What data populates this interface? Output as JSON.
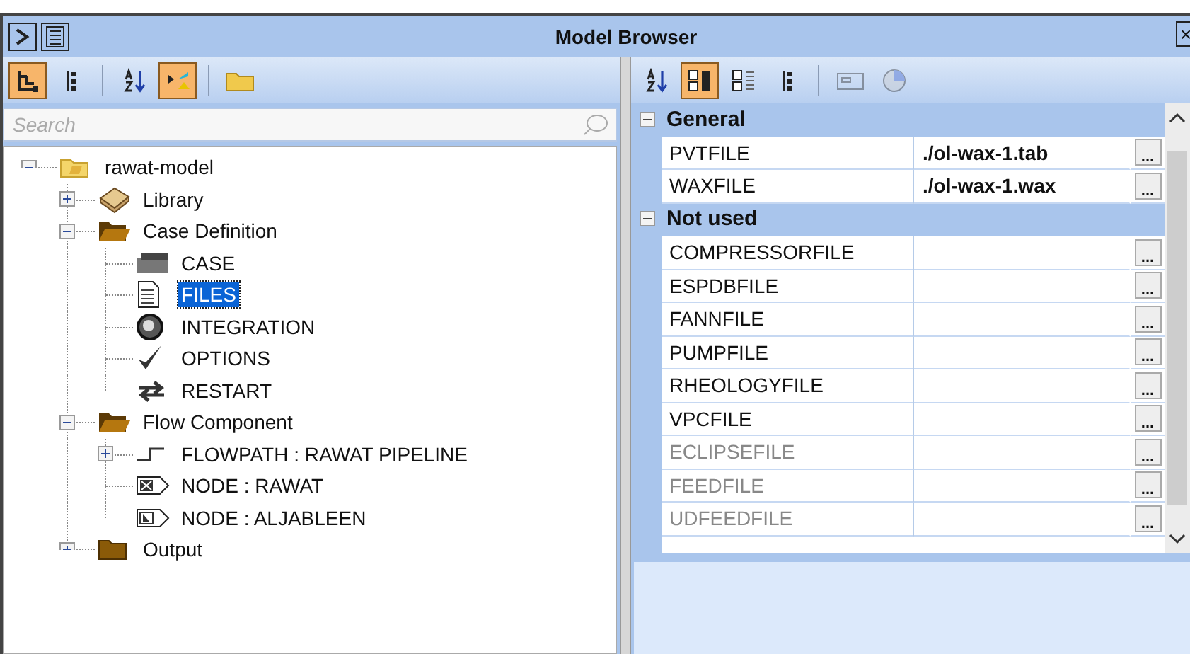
{
  "window": {
    "title": "Model Browser",
    "close": "×"
  },
  "left_toolbar": [
    {
      "kind": "tree",
      "selected": true
    },
    {
      "kind": "list",
      "selected": false
    },
    {
      "kind": "sort",
      "selected": false
    },
    {
      "kind": "filter",
      "selected": true
    },
    {
      "kind": "folder",
      "selected": false
    }
  ],
  "search": {
    "placeholder": "Search"
  },
  "tree": [
    {
      "label": "rawat-model",
      "kind": "project",
      "expanded": true,
      "selected": false,
      "children": [
        {
          "label": "Library",
          "kind": "book",
          "expanded": false,
          "selected": false
        },
        {
          "label": "Case Definition",
          "kind": "folder-open",
          "expanded": true,
          "selected": false,
          "children": [
            {
              "label": "CASE",
              "kind": "case",
              "selected": false
            },
            {
              "label": "FILES",
              "kind": "file",
              "selected": true
            },
            {
              "label": "INTEGRATION",
              "kind": "integration",
              "selected": false
            },
            {
              "label": "OPTIONS",
              "kind": "check",
              "selected": false
            },
            {
              "label": "RESTART",
              "kind": "restart",
              "selected": false
            }
          ]
        },
        {
          "label": "Flow Component",
          "kind": "folder-open",
          "expanded": true,
          "selected": false,
          "children": [
            {
              "label": "FLOWPATH : RAWAT PIPELINE",
              "kind": "flowpath",
              "expanded": false,
              "selected": false
            },
            {
              "label": "NODE : RAWAT",
              "kind": "node-x",
              "selected": false
            },
            {
              "label": "NODE : ALJABLEEN",
              "kind": "node-arrow",
              "selected": false
            }
          ]
        },
        {
          "label": "Output",
          "kind": "folder",
          "expanded": false,
          "selected": false
        }
      ]
    }
  ],
  "right_toolbar": [
    {
      "kind": "sort",
      "selected": false,
      "disabled": false
    },
    {
      "kind": "categorized",
      "selected": true,
      "disabled": false
    },
    {
      "kind": "alpha-list",
      "selected": false,
      "disabled": false
    },
    {
      "kind": "list",
      "selected": false,
      "disabled": false
    },
    {
      "kind": "grid",
      "selected": false,
      "disabled": true
    },
    {
      "kind": "pie",
      "selected": false,
      "disabled": true
    }
  ],
  "properties": [
    {
      "category": "General",
      "expanded": true,
      "rows": [
        {
          "name": "PVTFILE",
          "value": "./ol-wax-1.tab",
          "disabled": false,
          "button": "..."
        },
        {
          "name": "WAXFILE",
          "value": "./ol-wax-1.wax",
          "disabled": false,
          "button": "..."
        }
      ]
    },
    {
      "category": "Not used",
      "expanded": true,
      "rows": [
        {
          "name": "COMPRESSORFILE",
          "disabled": false,
          "button": "..."
        },
        {
          "name": "ESPDBFILE",
          "disabled": false,
          "button": "..."
        },
        {
          "name": "FANNFILE",
          "disabled": false,
          "button": "..."
        },
        {
          "name": "PUMPFILE",
          "disabled": false,
          "button": "..."
        },
        {
          "name": "RHEOLOGYFILE",
          "disabled": false,
          "button": "..."
        },
        {
          "name": "VPCFILE",
          "disabled": false,
          "button": "..."
        },
        {
          "name": "ECLIPSEFILE",
          "disabled": true,
          "button": "..."
        },
        {
          "name": "FEEDFILE",
          "disabled": true,
          "button": "..."
        },
        {
          "name": "UDFEEDFILE",
          "disabled": true,
          "button": "..."
        }
      ]
    }
  ]
}
